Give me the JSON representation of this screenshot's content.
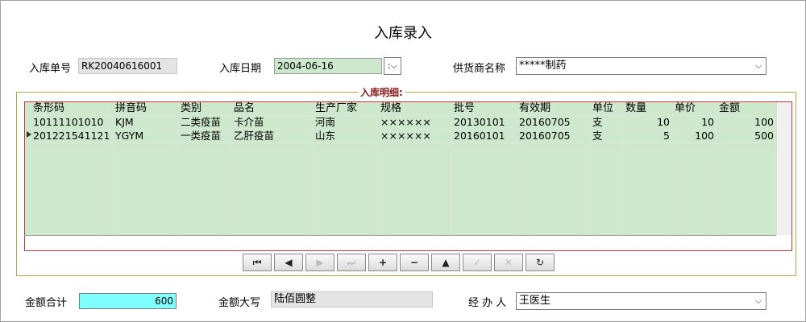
{
  "form": {
    "title": "入库录入",
    "order_no_label": "入库单号",
    "order_no_value": "RK20040616001",
    "date_label": "入库日期",
    "date_value": "2004-06-16",
    "supplier_label": "供货商名称",
    "supplier_value": "*****制药",
    "detail_group_label": "入库明细:"
  },
  "table": {
    "columns": [
      "条形码",
      "拼音码",
      "类别",
      "品名",
      "生产厂家",
      "规格",
      "批号",
      "有效期",
      "单位",
      "数量",
      "单价",
      "金额"
    ],
    "rows": [
      [
        "10111101010",
        "KJM",
        "二类疫苗",
        "卡介苗",
        "河南",
        "××××××",
        "20130101",
        "20160705",
        "支",
        "10",
        "10",
        "100"
      ],
      [
        "201221541121",
        "YGYM",
        "一类疫苗",
        "乙肝疫苗",
        "山东",
        "××××××",
        "20160101",
        "20160705",
        "支",
        "5",
        "100",
        "500"
      ]
    ],
    "selected_row": 1
  },
  "navigator": {
    "buttons": [
      {
        "name": "first-record-icon",
        "glyph": "⏮",
        "enabled": true
      },
      {
        "name": "prior-record-icon",
        "glyph": "◀",
        "enabled": true
      },
      {
        "name": "next-record-icon",
        "glyph": "▶",
        "enabled": false
      },
      {
        "name": "last-record-icon",
        "glyph": "⏭",
        "enabled": false
      },
      {
        "name": "insert-record-icon",
        "glyph": "+",
        "enabled": true
      },
      {
        "name": "delete-record-icon",
        "glyph": "−",
        "enabled": true
      },
      {
        "name": "edit-record-icon",
        "glyph": "▲",
        "enabled": true
      },
      {
        "name": "post-record-icon",
        "glyph": "✓",
        "enabled": false
      },
      {
        "name": "cancel-record-icon",
        "glyph": "✕",
        "enabled": false
      },
      {
        "name": "refresh-record-icon",
        "glyph": "↻",
        "enabled": true
      }
    ]
  },
  "footer": {
    "total_label": "金额合计",
    "total_value": "600",
    "uppercase_label": "金额大写",
    "uppercase_value": "陆佰圆整",
    "handler_label": "经 办 人",
    "handler_value": "王医生"
  },
  "colors": {
    "grid_bg": "#cde8cc",
    "total_bg": "#7fffff",
    "group_title": "#8b1a1a"
  }
}
